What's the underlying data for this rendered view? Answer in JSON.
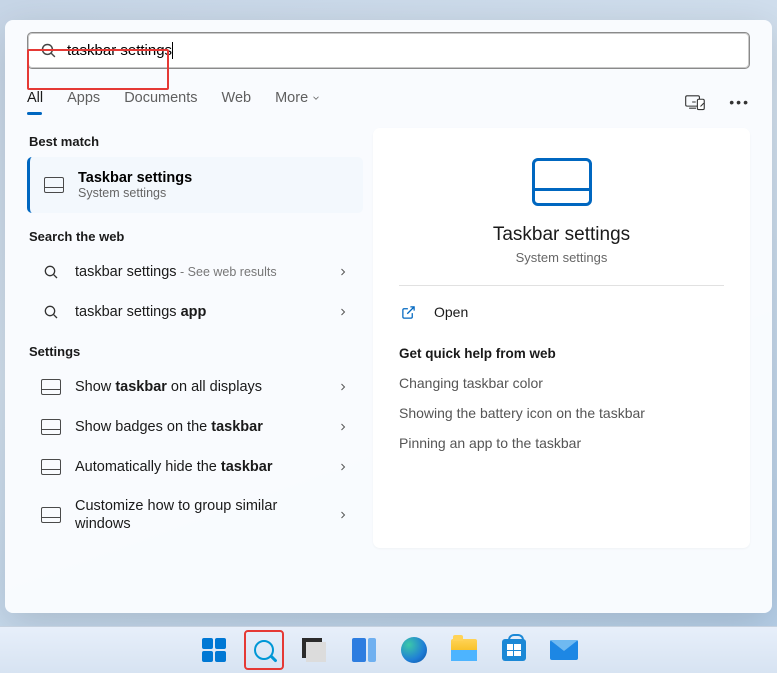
{
  "search": {
    "value": "taskbar settings"
  },
  "tabs": [
    "All",
    "Apps",
    "Documents",
    "Web",
    "More"
  ],
  "activeTab": "All",
  "sections": {
    "best": "Best match",
    "web": "Search the web",
    "settings": "Settings"
  },
  "bestMatch": {
    "title": "Taskbar settings",
    "subtitle": "System settings"
  },
  "webResults": [
    {
      "prefix": "taskbar settings",
      "suffix": " - See web results"
    },
    {
      "prefix": "taskbar settings ",
      "bold": "app"
    }
  ],
  "settingsResults": [
    {
      "pre": "Show ",
      "bold": "taskbar",
      "post": " on all displays"
    },
    {
      "pre": "Show badges on the ",
      "bold": "taskbar",
      "post": ""
    },
    {
      "pre": "Automatically hide the ",
      "bold": "taskbar",
      "post": ""
    },
    {
      "pre": "Customize how to group similar windows",
      "bold": "",
      "post": "",
      "multi": true
    }
  ],
  "preview": {
    "title": "Taskbar settings",
    "subtitle": "System settings",
    "open": "Open",
    "helpHeading": "Get quick help from web",
    "helpLinks": [
      "Changing taskbar color",
      "Showing the battery icon on the taskbar",
      "Pinning an app to the taskbar"
    ]
  },
  "taskbarIcons": [
    "start",
    "search",
    "task-view",
    "widgets",
    "edge",
    "explorer",
    "store",
    "mail"
  ]
}
